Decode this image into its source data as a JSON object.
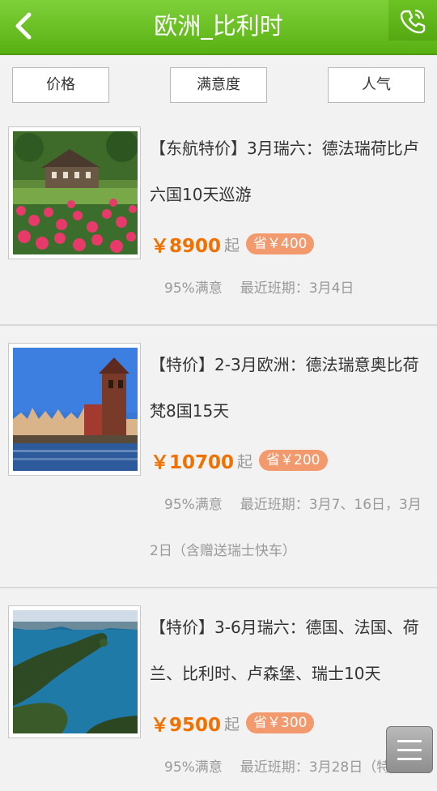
{
  "header": {
    "title": "欧洲_比利时",
    "back_icon": "chevron-left-icon",
    "phone_icon": "phone-icon"
  },
  "filters": [
    "价格",
    "满意度",
    "人气"
  ],
  "products": [
    {
      "title": "【东航特价】3月瑞六：德法瑞荷比卢六国10天巡游",
      "price": "￥8900",
      "qi": "起",
      "save": "省￥400",
      "satisfaction": "95%满意",
      "schedule": "最近班期：3月4日",
      "image": "garden-house"
    },
    {
      "title": "【特价】2-3月欧洲：德法瑞意奥比荷梵8国15天",
      "price": "￥10700",
      "qi": "起",
      "save": "省￥200",
      "satisfaction": "95%满意",
      "schedule": "最近班期：3月7、16日，3月2日（含赠送瑞士快车）",
      "image": "harbor-town"
    },
    {
      "title": "【特价】3-6月瑞六：德国、法国、荷兰、比利时、卢森堡、瑞士10天",
      "price": "￥9500",
      "qi": "起",
      "save": "省￥300",
      "satisfaction": "95%满意",
      "schedule": "最近班期：3月28日（特",
      "image": "lake-coast"
    }
  ],
  "colors": {
    "header_green": "#58b012",
    "price_orange": "#f07000",
    "save_badge": "#f29a6e"
  },
  "floating_menu_icon": "hamburger-menu-icon"
}
